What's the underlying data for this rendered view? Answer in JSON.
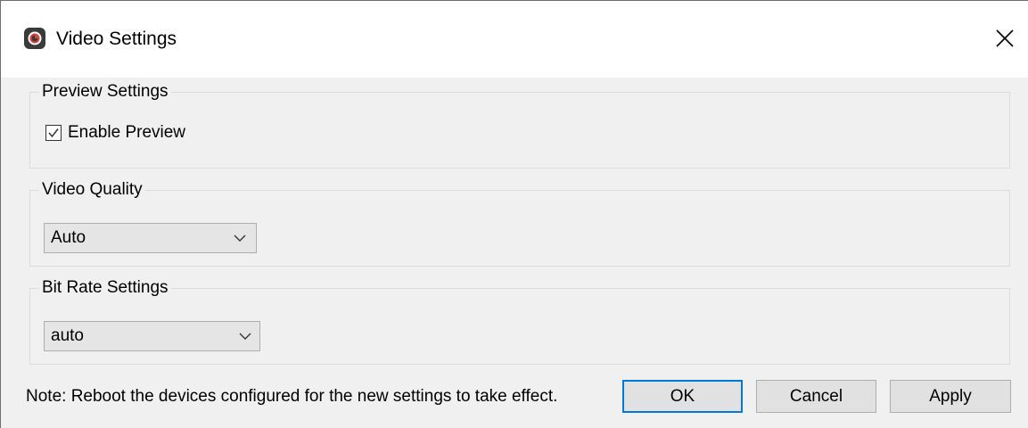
{
  "window": {
    "title": "Video Settings",
    "app_icon": "app-logo-icon",
    "close_icon": "close-icon"
  },
  "preview_settings": {
    "legend": "Preview Settings",
    "enable_preview": {
      "label": "Enable Preview",
      "checked": true
    }
  },
  "video_quality": {
    "legend": "Video Quality",
    "selected": "Auto"
  },
  "bit_rate_settings": {
    "legend": "Bit Rate Settings",
    "selected": "auto"
  },
  "footer": {
    "note": "Note: Reboot the devices configured for the new settings to take effect.",
    "ok_label": "OK",
    "cancel_label": "Cancel",
    "apply_label": "Apply"
  },
  "colors": {
    "accent": "#0078d7",
    "dialog_background": "#f0f0f0",
    "titlebar_background": "#ffffff"
  }
}
